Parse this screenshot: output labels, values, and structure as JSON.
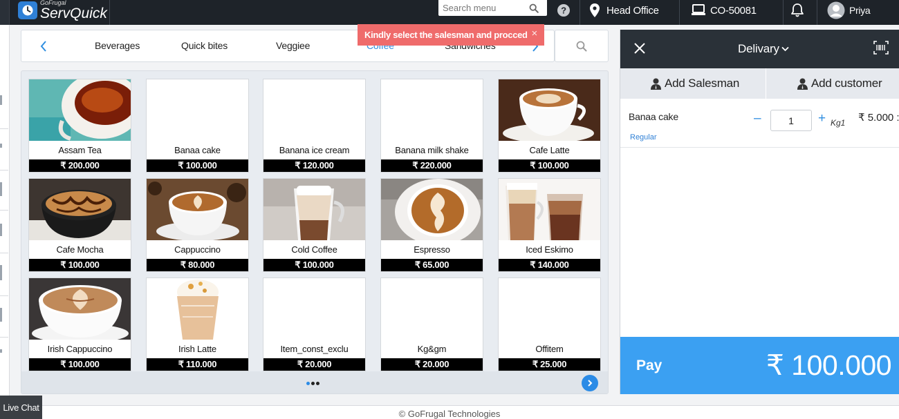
{
  "header": {
    "brand_small": "GoFrugal",
    "brand": "ServQuick",
    "search_placeholder": "Search menu",
    "location": "Head Office",
    "counter": "CO-50081",
    "user": "Priya"
  },
  "toast": {
    "message": "Kindly select the salesman and procced",
    "close": "×"
  },
  "categories": [
    {
      "label": "Beverages"
    },
    {
      "label": "Quick bites"
    },
    {
      "label": "Veggiee"
    },
    {
      "label": "Coffee"
    },
    {
      "label": "Sandwiches"
    }
  ],
  "products": [
    {
      "name": "Assam Tea",
      "price": "₹ 200.000",
      "image": "tea"
    },
    {
      "name": "Banaa cake",
      "price": "₹ 100.000",
      "image": ""
    },
    {
      "name": "Banana ice cream",
      "price": "₹ 120.000",
      "image": ""
    },
    {
      "name": "Banana milk shake",
      "price": "₹ 220.000",
      "image": ""
    },
    {
      "name": "Cafe Latte",
      "price": "₹ 100.000",
      "image": "latte"
    },
    {
      "name": "Cafe Mocha",
      "price": "₹ 100.000",
      "image": "mocha"
    },
    {
      "name": "Cappuccino",
      "price": "₹ 80.000",
      "image": "cappuccino"
    },
    {
      "name": "Cold Coffee",
      "price": "₹ 100.000",
      "image": "coldcoffee"
    },
    {
      "name": "Espresso",
      "price": "₹ 65.000",
      "image": "espresso"
    },
    {
      "name": "Iced Eskimo",
      "price": "₹ 140.000",
      "image": "iced"
    },
    {
      "name": "Irish Cappuccino",
      "price": "₹ 100.000",
      "image": "irishcap"
    },
    {
      "name": "Irish Latte",
      "price": "₹ 110.000",
      "image": "irishlatte"
    },
    {
      "name": "Item_const_exclu",
      "price": "₹ 20.000",
      "image": ""
    },
    {
      "name": "Kg&gm",
      "price": "₹ 20.000",
      "image": ""
    },
    {
      "name": "Offitem",
      "price": "₹ 25.000",
      "image": ""
    }
  ],
  "order": {
    "mode": "Delivary",
    "add_salesman": "Add Salesman",
    "add_customer": "Add customer",
    "items": [
      {
        "name": "Banaa cake",
        "price_type": "Regular",
        "qty": "1",
        "unit": "Kg1",
        "amount": "₹ 5.000 :"
      }
    ],
    "pay_label": "Pay",
    "total": "₹ 100.000"
  },
  "footer": {
    "copyright": "© GoFrugal Technologies",
    "live_chat": "Live Chat"
  },
  "colors": {
    "topbar": "#1e2329",
    "accent": "#3ba0f2",
    "toast": "#ef6b6b",
    "active_category": "#2f8ee0"
  }
}
